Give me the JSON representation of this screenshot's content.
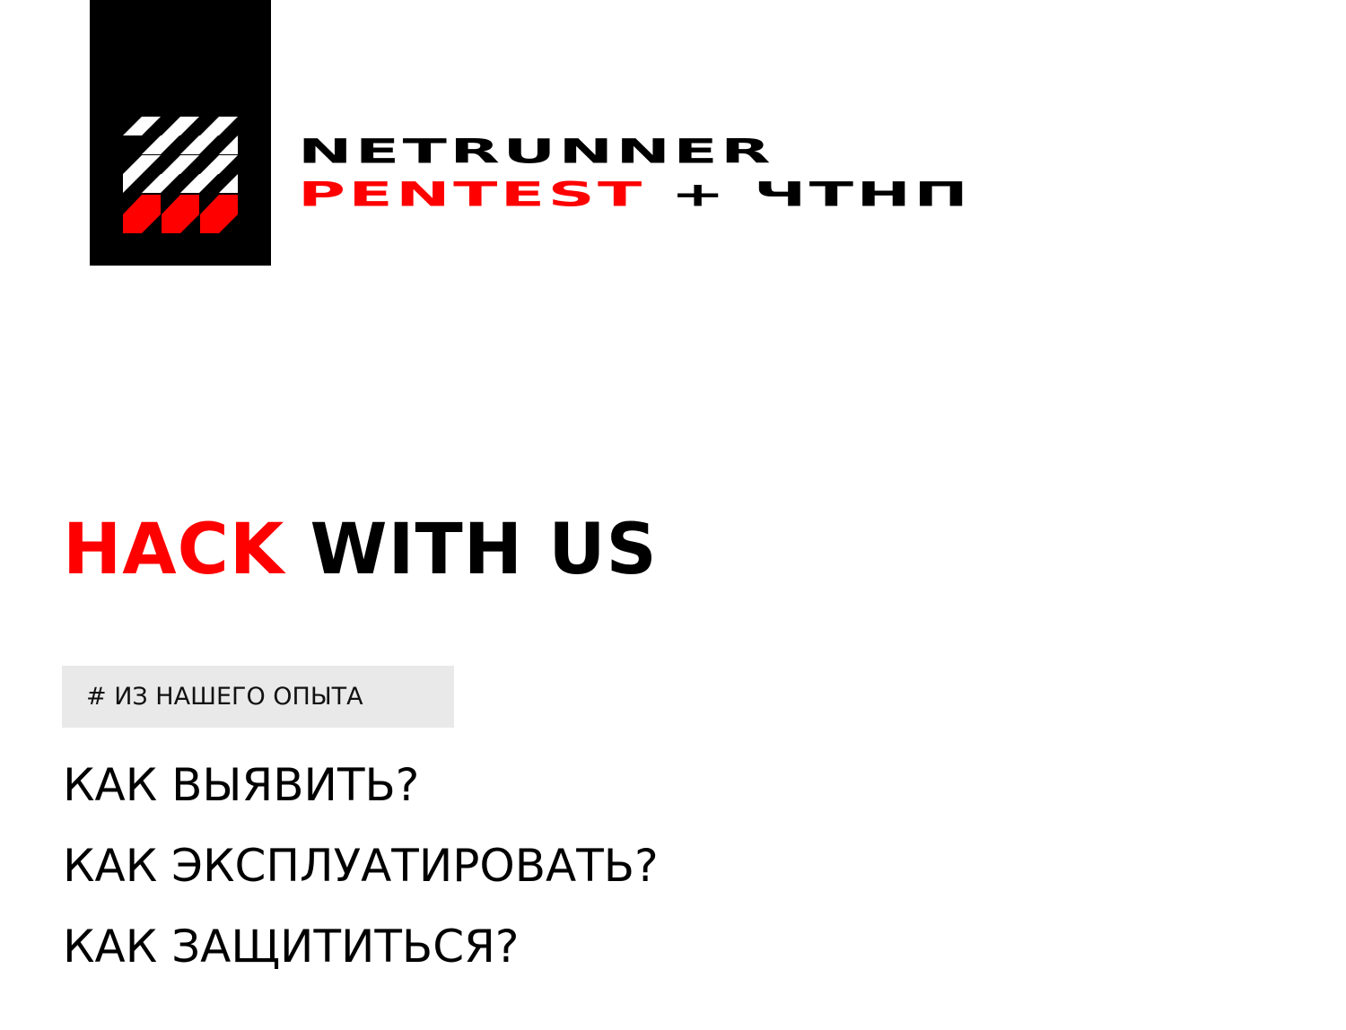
{
  "logo": {
    "icon": "checkered-flag-logo-icon",
    "colors": {
      "background": "#000000",
      "light": "#ffffff",
      "accent": "#ff0000"
    }
  },
  "brand": {
    "line1": "NETRUNNER",
    "line2_red": "PENTEST",
    "line2_rest": "+ ЧТНП"
  },
  "headline": {
    "red": "HACK",
    "dark": "WITH US",
    "colors": {
      "accent": "#ff0000",
      "text": "#000000"
    }
  },
  "tag": {
    "label": "# ИЗ НАШЕГО ОПЫТА",
    "background": "#e9e9e9"
  },
  "questions": [
    "КАК ВЫЯВИТЬ?",
    "КАК ЭКСПЛУАТИРОВАТЬ?",
    "КАК ЗАЩИТИТЬСЯ?"
  ]
}
